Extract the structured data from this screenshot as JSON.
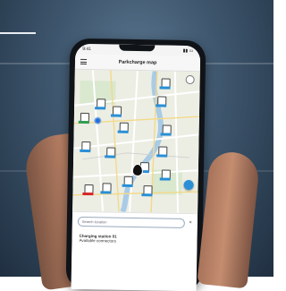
{
  "app": {
    "title": "Parkcharge map",
    "status_time": "9:41"
  },
  "search": {
    "placeholder": "Search location"
  },
  "sheet": {
    "title": "Charging station 01",
    "subtitle": "Available connectors"
  },
  "colors": {
    "accent": "#2a8fd6",
    "alert": "#d6262a",
    "available": "#2f9e53"
  },
  "icons": {
    "menu": "menu-icon",
    "locate": "locate-icon",
    "fab": "navigate-icon",
    "close": "close-icon"
  }
}
